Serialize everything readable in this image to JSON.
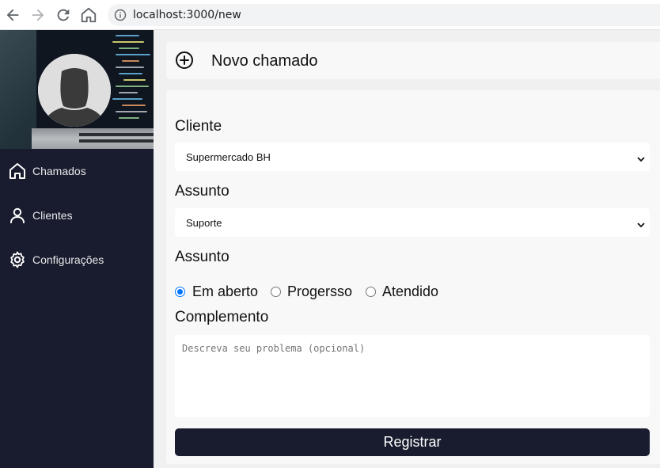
{
  "browser": {
    "url": "localhost:3000/new",
    "icons": [
      "back-arrow-icon",
      "forward-arrow-icon",
      "reload-icon",
      "home-icon",
      "info-icon"
    ]
  },
  "sidebar": {
    "items": [
      {
        "label": "Chamados",
        "icon": "home-icon"
      },
      {
        "label": "Clientes",
        "icon": "user-icon"
      },
      {
        "label": "Configurações",
        "icon": "gear-icon"
      }
    ]
  },
  "header": {
    "title": "Novo chamado",
    "icon": "plus-circle-icon"
  },
  "form": {
    "cliente_label": "Cliente",
    "cliente_value": "Supermercado BH",
    "assunto_label": "Assunto",
    "assunto_value": "Suporte",
    "status_label": "Assunto",
    "status_options": [
      {
        "label": "Em aberto",
        "checked": true
      },
      {
        "label": "Progersso",
        "checked": false
      },
      {
        "label": "Atendido",
        "checked": false
      }
    ],
    "complemento_label": "Complemento",
    "complemento_placeholder": "Descreva seu problema (opcional)",
    "submit_label": "Registrar"
  },
  "colors": {
    "sidebar_bg": "#181c2e",
    "button_bg": "#181c2e",
    "radio_accent": "#0075ff"
  }
}
